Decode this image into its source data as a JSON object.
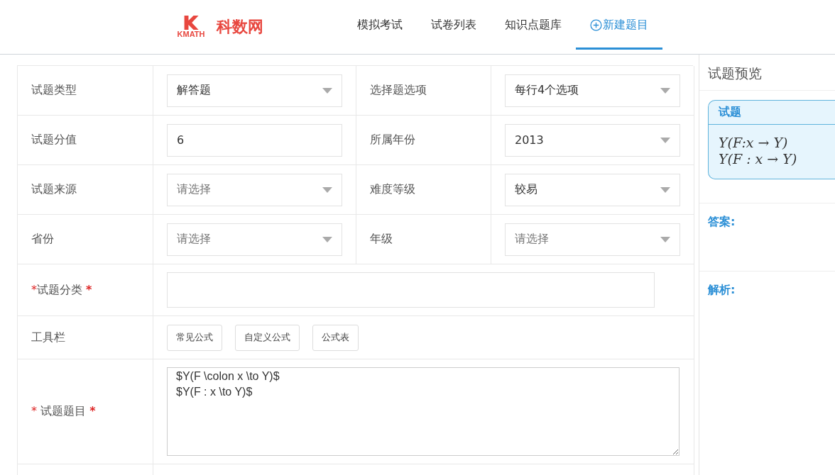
{
  "header": {
    "logo_mark": "KMATH",
    "logo_text": "科数网",
    "nav": [
      {
        "label": "模拟考试",
        "selected": false,
        "kind": "link"
      },
      {
        "label": "试卷列表",
        "selected": false,
        "kind": "link"
      },
      {
        "label": "知识点题库",
        "selected": false,
        "kind": "link"
      },
      {
        "label": "新建题目",
        "selected": true,
        "kind": "create"
      }
    ]
  },
  "form": {
    "pairs": [
      [
        {
          "label": "试题类型",
          "kind": "select",
          "value": "解答题"
        },
        {
          "label": "选择题选项",
          "kind": "select",
          "value": "每行4个选项"
        }
      ],
      [
        {
          "label": "试题分值",
          "kind": "input",
          "value": "6"
        },
        {
          "label": "所属年份",
          "kind": "select",
          "value": "2013"
        }
      ],
      [
        {
          "label": "试题来源",
          "kind": "select",
          "placeholder": "请选择"
        },
        {
          "label": "难度等级",
          "kind": "select",
          "value": "较易"
        }
      ],
      [
        {
          "label": "省份",
          "kind": "select",
          "placeholder": "请选择"
        },
        {
          "label": "年级",
          "kind": "select",
          "placeholder": "请选择"
        }
      ]
    ],
    "category": {
      "mark_before": "*",
      "label": "试题分类",
      "mark_after": "*"
    },
    "toolbar": {
      "label": "工具栏",
      "buttons": [
        "常见公式",
        "自定义公式",
        "公式表"
      ]
    },
    "question": {
      "mark_before": "*",
      "label": "试题题目",
      "mark_after": "*",
      "value": "$Y(F \\colon x \\to Y)$\n$Y(F : x \\to Y)$"
    }
  },
  "preview": {
    "title": "试题预览",
    "card_title": "试题",
    "lines": [
      "Y(F:x → Y)",
      "Y(F : x → Y)"
    ],
    "answer_label": "答案:",
    "analysis_label": "解析:"
  }
}
